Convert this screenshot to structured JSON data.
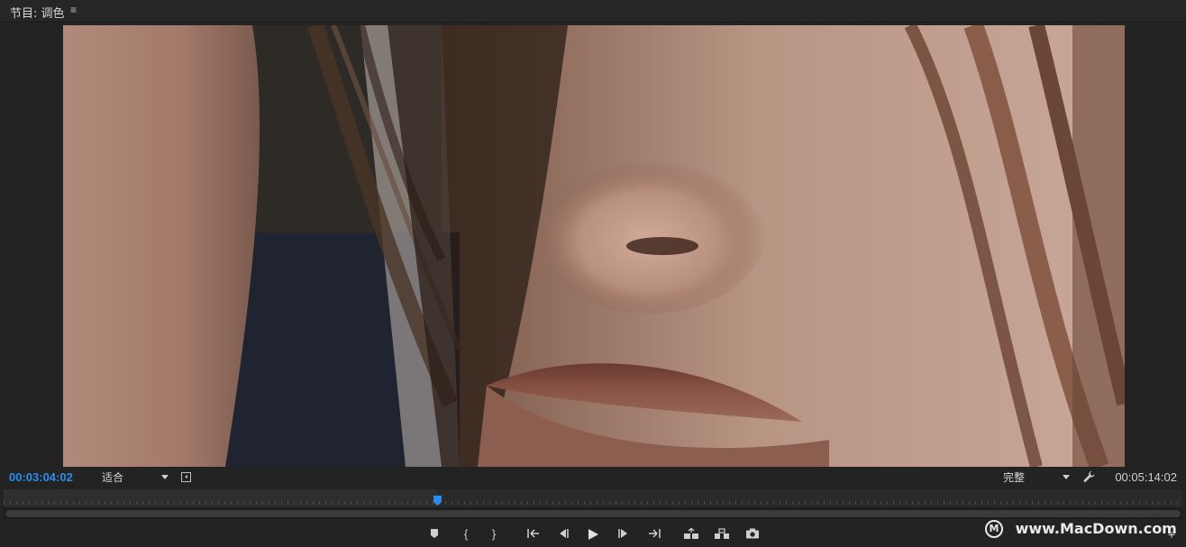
{
  "panel": {
    "title": "节目: 调色",
    "menu_icon": "hamburger-menu-icon"
  },
  "playback": {
    "current_timecode": "00:03:04:02",
    "duration_timecode": "00:05:14:02",
    "playhead_fraction": 0.368
  },
  "view": {
    "zoom_level": "适合",
    "playback_resolution": "完整"
  },
  "colors": {
    "accent": "#2d8ceb",
    "panel_bg": "#232323",
    "text": "#cfcfcf"
  },
  "transport_icons": [
    "add-marker-icon",
    "mark-in-icon",
    "mark-out-icon",
    "go-to-in-icon",
    "step-back-icon",
    "play-icon",
    "step-forward-icon",
    "go-to-out-icon",
    "lift-icon",
    "extract-icon",
    "export-frame-icon"
  ],
  "watermark": {
    "text": "www.MacDown.com"
  }
}
